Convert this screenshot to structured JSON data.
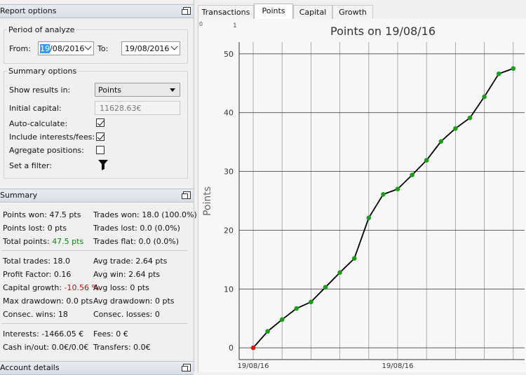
{
  "report_options": {
    "title": "Report options",
    "period": {
      "title": "Period of analyze",
      "from_label": "From:",
      "from_value": "19/08/2016",
      "to_label": "To:",
      "to_value": "19/08/2016"
    },
    "summary_options": {
      "title": "Summary options",
      "show_results_label": "Show results in:",
      "show_results_value": "Points",
      "initial_capital_label": "Initial capital:",
      "initial_capital_value": "11628.63€",
      "auto_calculate_label": "Auto-calculate:",
      "auto_calculate_checked": true,
      "include_interests_label": "Include interests/fees:",
      "include_interests_checked": true,
      "aggregate_label": "Agregate positions:",
      "aggregate_checked": false,
      "filter_label": "Set a filter:",
      "filter_icon": "filter-funnel-icon"
    }
  },
  "summary": {
    "title": "Summary",
    "points_won": "Points won: 47.5 pts",
    "points_lost": "Points lost: 0 pts",
    "total_points_label": "Total points: ",
    "total_points_value": "47.5 pts",
    "trades_won": "Trades won: 18.0 (100.0%)",
    "trades_lost": "Trades lost: 0.0 (0.0%)",
    "trades_flat": "Trades flat: 0.0 (0.0%)",
    "total_trades": "Total trades: 18.0",
    "profit_factor": "Profit Factor: 0.16",
    "capital_growth_label": "Capital growth: ",
    "capital_growth_value": "-10.56 %",
    "max_drawdown": "Max drawdown: 0.0 pts",
    "consec_wins": "Consec. wins: 18",
    "avg_trade": "Avg trade: 2.64 pts",
    "avg_win": "Avg win: 2.64 pts",
    "avg_loss": "Avg loss: 0 pts",
    "avg_drawdown": "Avg drawdown: 0 pts",
    "consec_losses": "Consec. losses: 0",
    "interests": "Interests: -1466.05 €",
    "cash_in_out": "Cash in/out: 0.0€/0.0€",
    "fees": "Fees: 0 €",
    "transfers": "Transfers: 0.0€"
  },
  "account_details": {
    "title": "Account details"
  },
  "tabs": [
    "Transactions",
    "Points",
    "Capital",
    "Growth"
  ],
  "active_tab": "Points",
  "colors": {
    "line": "#000000",
    "point": "#1a9e1a",
    "start_point": "#e01010",
    "grid": "#4a4a4a"
  },
  "chart_data": {
    "type": "line",
    "title": "Points on 19/08/16",
    "ylabel": "Points",
    "xlabel": "",
    "top_tick_labels": [
      "0",
      "1"
    ],
    "x_tick_labels": [
      "19/08/16",
      "19/08/16"
    ],
    "ylim": [
      -2,
      52
    ],
    "yticks": [
      0,
      10,
      20,
      30,
      40,
      50
    ],
    "grid": true,
    "series": [
      {
        "values": [
          0,
          2.8,
          4.8,
          6.7,
          7.8,
          10.3,
          12.8,
          15.2,
          22.1,
          26.1,
          27.0,
          29.4,
          31.9,
          35.1,
          37.3,
          39.1,
          42.7,
          46.6,
          47.5
        ]
      }
    ]
  }
}
